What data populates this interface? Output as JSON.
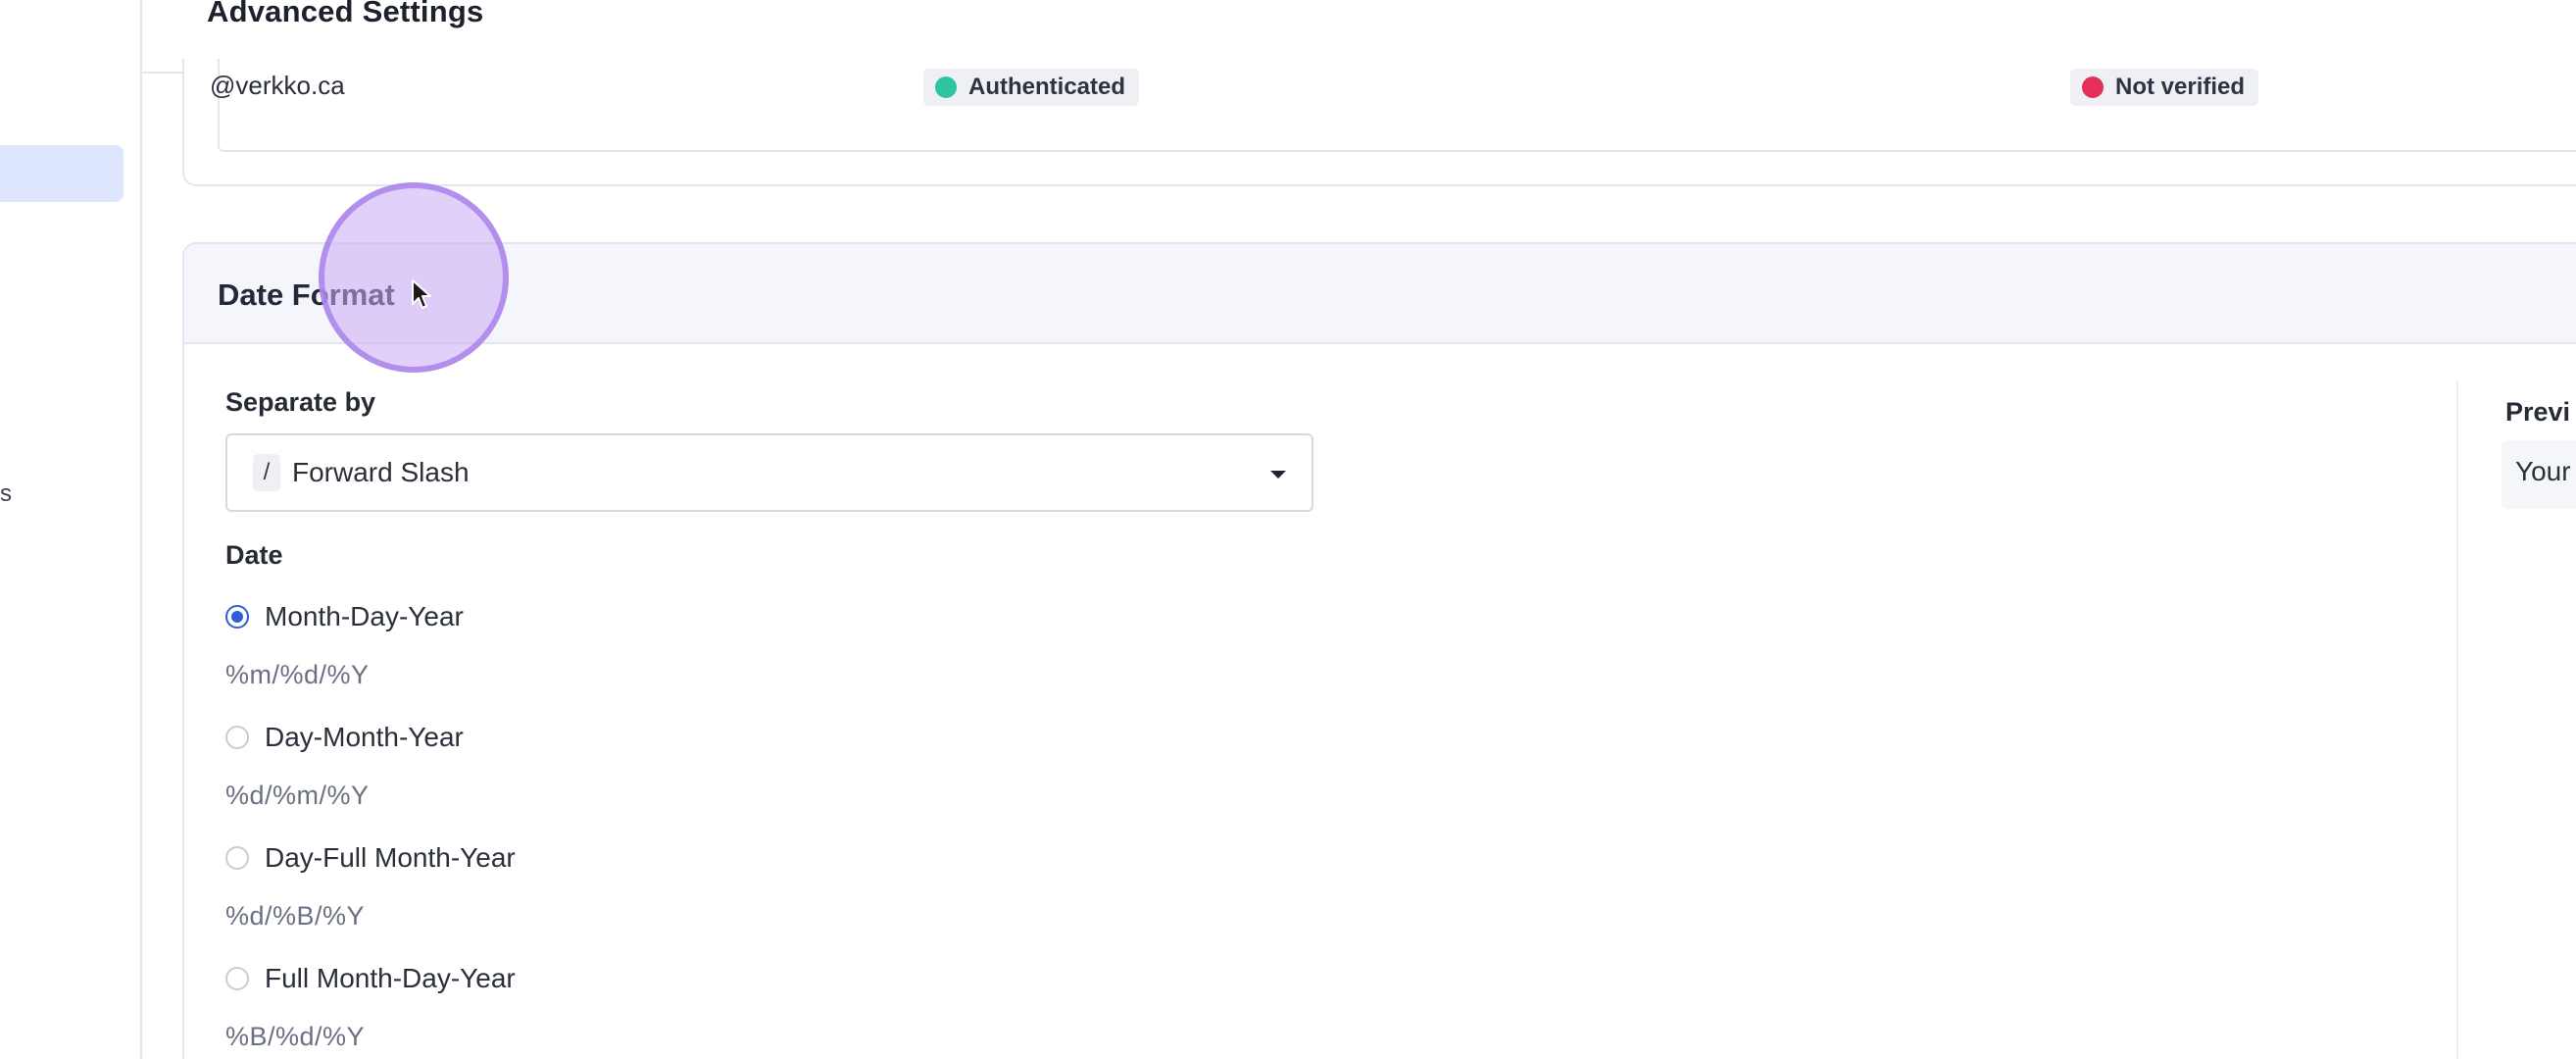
{
  "header": {
    "title": "Advanced Settings"
  },
  "sidebar": {
    "fragment_text": "s"
  },
  "domains": {
    "row": {
      "domain": "@verkko.ca",
      "status_auth": "Authenticated",
      "status_verify": "Not verified"
    }
  },
  "date_format": {
    "title": "Date Format",
    "separator": {
      "label": "Separate by",
      "glyph": "/",
      "selected": "Forward Slash"
    },
    "date_label": "Date",
    "options": [
      {
        "label": "Month-Day-Year",
        "pattern": "%m/%d/%Y",
        "checked": true
      },
      {
        "label": "Day-Month-Year",
        "pattern": "%d/%m/%Y",
        "checked": false
      },
      {
        "label": "Day-Full Month-Year",
        "pattern": "%d/%B/%Y",
        "checked": false
      },
      {
        "label": "Full Month-Day-Year",
        "pattern": "%B/%d/%Y",
        "checked": false
      }
    ],
    "preview": {
      "label": "Previ",
      "text": "Your"
    }
  },
  "colors": {
    "accent": "#2f5fd8",
    "status_success": "#2ec4a0",
    "status_error": "#e5305a",
    "sidebar_active": "#dde6fd",
    "click_highlight": "#c8aaf5"
  },
  "icons": {
    "dropdown": "caret-down-icon",
    "cursor": "mouse-pointer-icon"
  }
}
